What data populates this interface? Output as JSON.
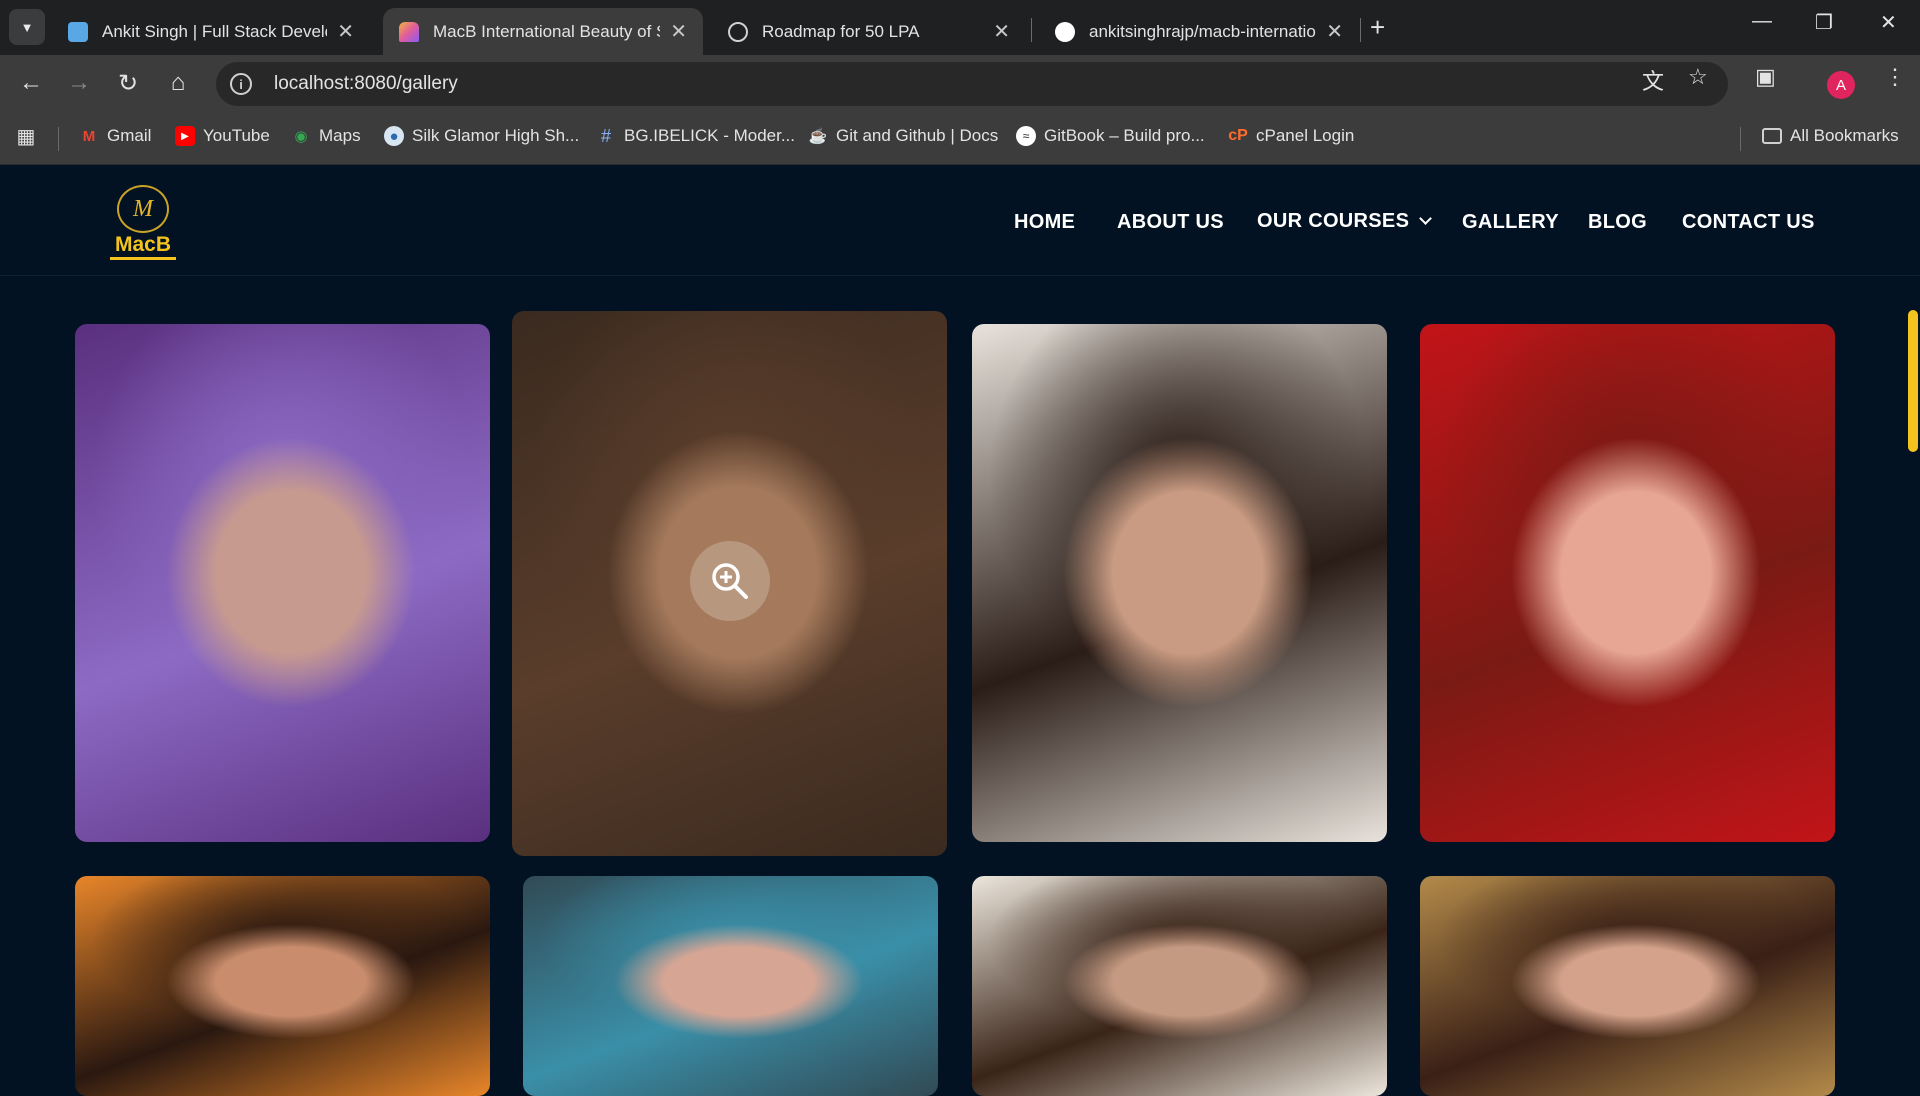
{
  "browser": {
    "tabs": [
      {
        "title": "Ankit Singh | Full Stack Develop",
        "active": false,
        "favicon_color": "#5aa7e6"
      },
      {
        "title": "MacB International Beauty of Sc",
        "active": true,
        "favicon_color": "#e05d9b"
      },
      {
        "title": "Roadmap for 50 LPA",
        "active": false,
        "favicon_color": "#d0d0d0"
      },
      {
        "title": "ankitsinghrajp/macb-internatio",
        "active": false,
        "favicon_color": "#ffffff"
      }
    ],
    "new_tab_label": "+",
    "url": "localhost:8080/gallery",
    "profile_initial": "A",
    "bookmarks": [
      {
        "label": "Gmail",
        "icon": "gmail-icon"
      },
      {
        "label": "YouTube",
        "icon": "youtube-icon"
      },
      {
        "label": "Maps",
        "icon": "maps-icon"
      },
      {
        "label": "Silk Glamor High Sh...",
        "icon": "globe-icon"
      },
      {
        "label": "BG.IBELICK - Moder...",
        "icon": "hash-icon"
      },
      {
        "label": "Git and Github | Docs",
        "icon": "cup-icon"
      },
      {
        "label": "GitBook – Build pro...",
        "icon": "gitbook-icon"
      },
      {
        "label": "cPanel Login",
        "icon": "cpanel-icon"
      }
    ],
    "all_bookmarks_label": "All Bookmarks"
  },
  "site": {
    "logo_monogram": "M",
    "logo_text": "MacB",
    "nav": [
      {
        "label": "HOME"
      },
      {
        "label": "ABOUT US"
      },
      {
        "label": "OUR COURSES",
        "has_dropdown": true
      },
      {
        "label": "GALLERY"
      },
      {
        "label": "BLOG"
      },
      {
        "label": "CONTACT US"
      }
    ],
    "accent_color": "#f5c31d",
    "background_color": "#021223",
    "gallery": [
      {
        "name": "gallery-image-purple-makeup",
        "palette": [
          "#5a2f7f",
          "#c79a8f",
          "#8d6bc4"
        ]
      },
      {
        "name": "gallery-image-beret-portrait",
        "palette": [
          "#3a2a1f",
          "#a57a5c",
          "#5a3d2b"
        ]
      },
      {
        "name": "gallery-image-classic-waves",
        "palette": [
          "#e8e3dc",
          "#c99b82",
          "#2a1c16"
        ]
      },
      {
        "name": "gallery-image-red-glam",
        "palette": [
          "#c21418",
          "#e7a593",
          "#7a1a14"
        ]
      },
      {
        "name": "gallery-image-orange-scarf",
        "palette": [
          "#e8862a",
          "#c98d6d",
          "#2a1810"
        ]
      },
      {
        "name": "gallery-image-blue-eyeshadow",
        "palette": [
          "#314a55",
          "#d7a594",
          "#3a8fa8"
        ]
      },
      {
        "name": "gallery-image-bridal-tikka",
        "palette": [
          "#ece6dc",
          "#c59a82",
          "#3a2418"
        ]
      },
      {
        "name": "gallery-image-bridal-gold",
        "palette": [
          "#b38a4a",
          "#d4a28a",
          "#3a2016"
        ]
      }
    ]
  }
}
